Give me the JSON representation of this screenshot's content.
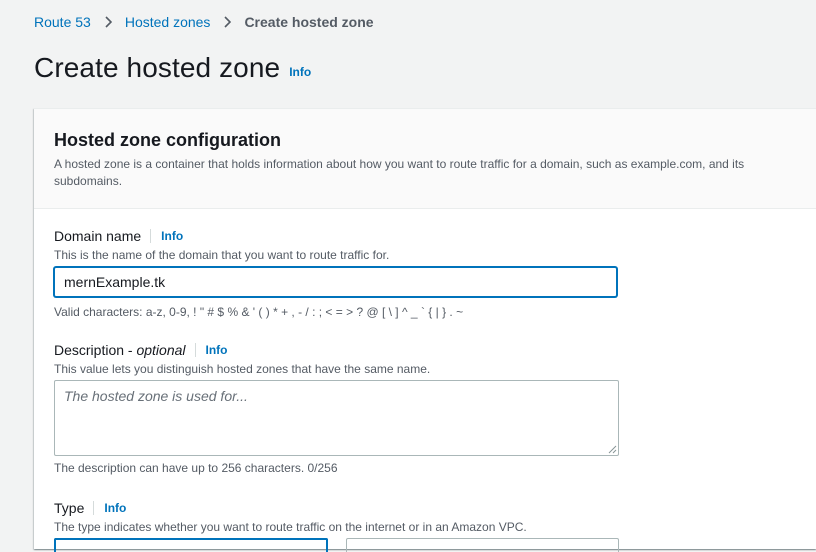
{
  "breadcrumb": {
    "items": [
      "Route 53",
      "Hosted zones"
    ],
    "current": "Create hosted zone"
  },
  "page": {
    "title": "Create hosted zone",
    "info": "Info"
  },
  "config": {
    "title": "Hosted zone configuration",
    "description": "A hosted zone is a container that holds information about how you want to route traffic for a domain, such as example.com, and its subdomains.",
    "domain": {
      "label": "Domain name",
      "info": "Info",
      "description": "This is the name of the domain that you want to route traffic for.",
      "value": "mernExample.tk",
      "constraint": "Valid characters: a-z, 0-9, ! \" # $ % & ' ( ) * + , - / : ; < = > ? @ [ \\ ] ^ _ ` { | } . ~"
    },
    "description_field": {
      "label": "Description - ",
      "label_optional": "optional",
      "info": "Info",
      "description": "This value lets you distinguish hosted zones that have the same name.",
      "placeholder": "The hosted zone is used for...",
      "constraint": "The description can have up to 256 characters. 0/256"
    },
    "type": {
      "label": "Type",
      "info": "Info",
      "description": "The type indicates whether you want to route traffic on the internet or in an Amazon VPC."
    }
  },
  "colors": {
    "link": "#0073bb",
    "page_bg": "#f2f3f3",
    "focus_border": "#0073bb"
  }
}
